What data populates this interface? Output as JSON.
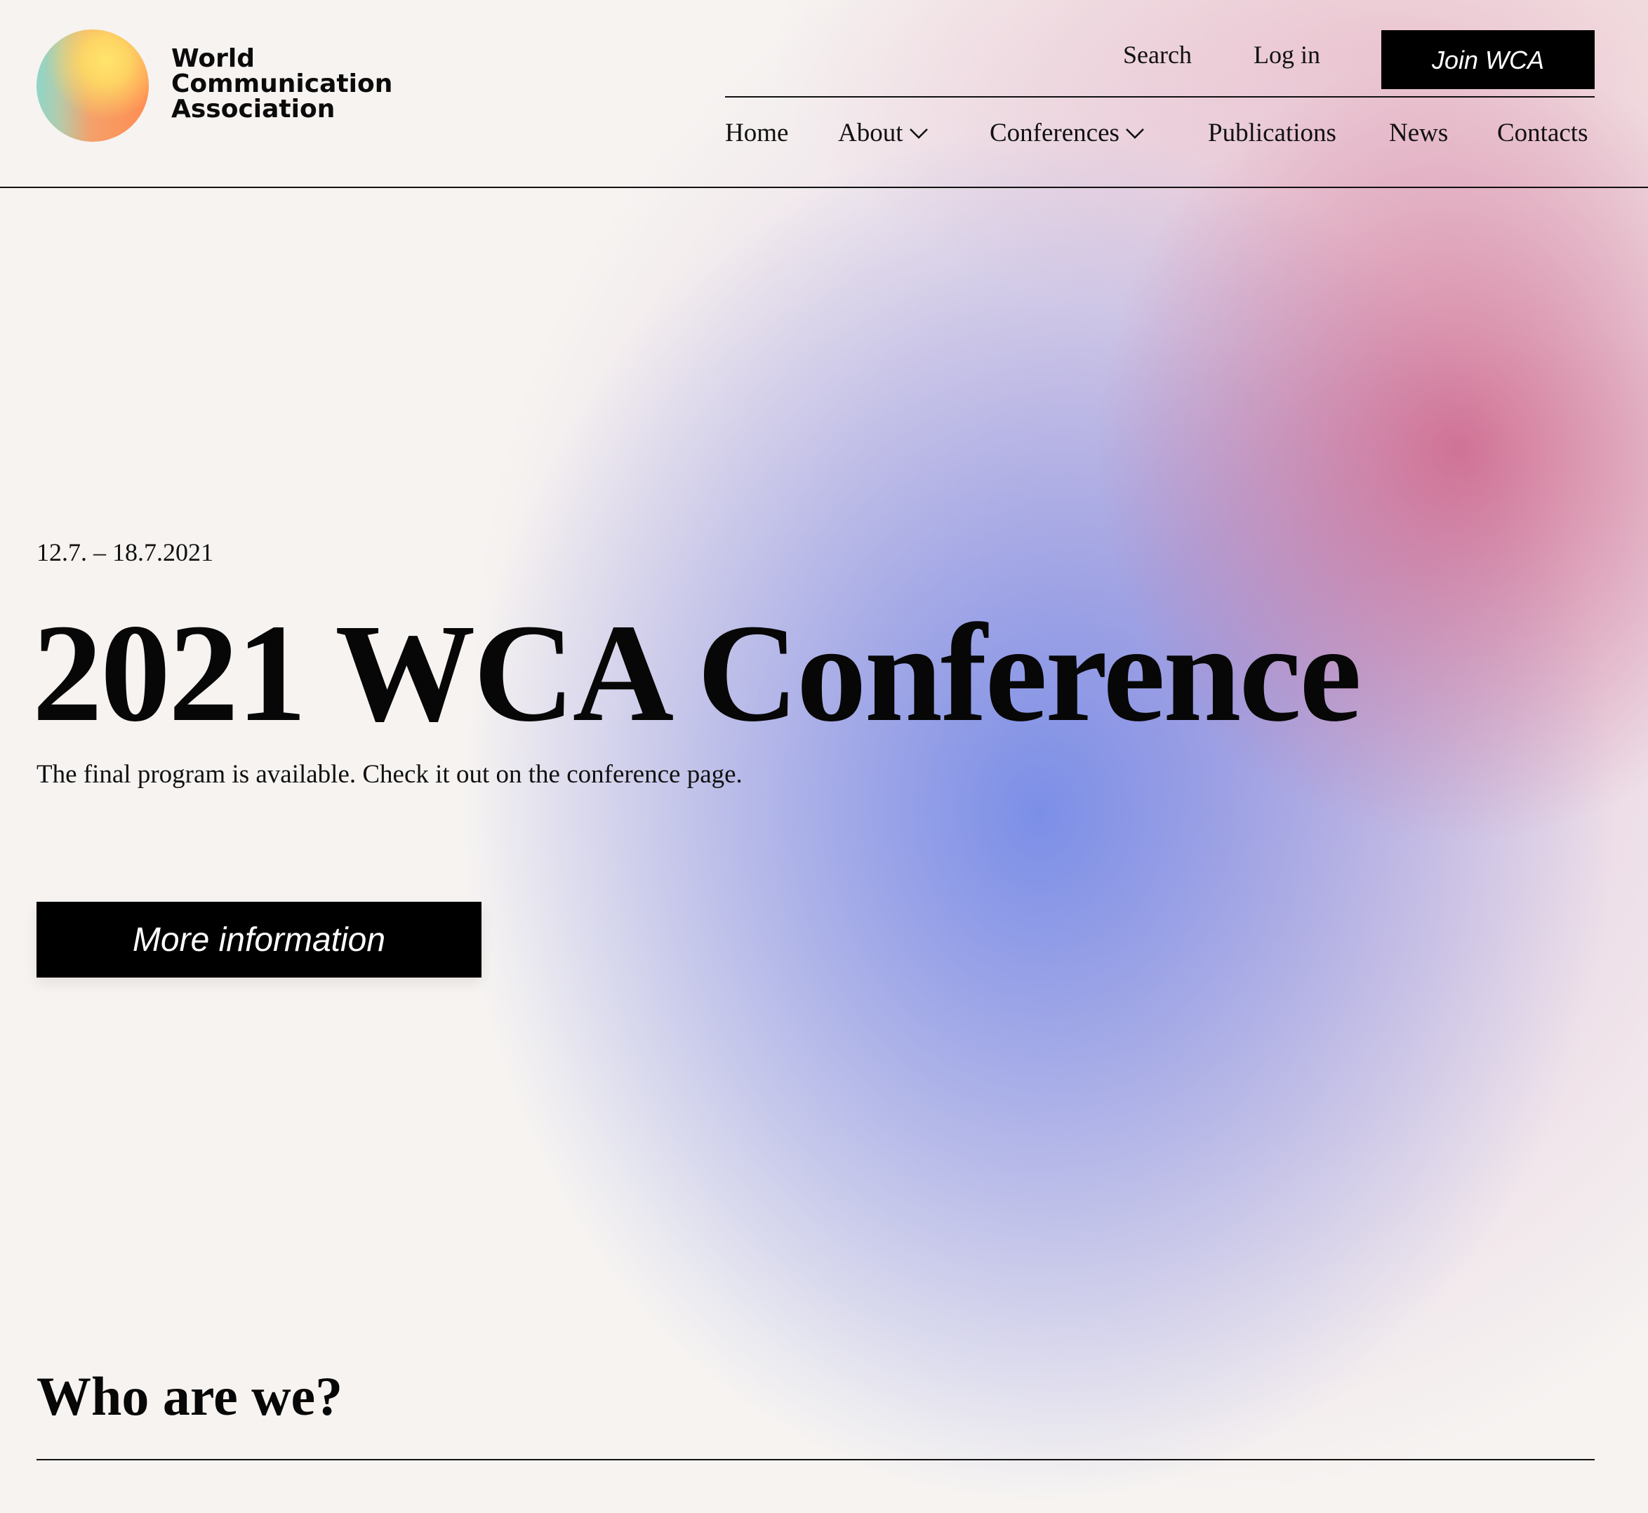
{
  "brand": {
    "line1": "World",
    "line2": "Communication",
    "line3": "Association"
  },
  "header": {
    "search_label": "Search",
    "login_label": "Log in",
    "join_label": "Join WCA"
  },
  "nav": {
    "home": "Home",
    "about": "About",
    "conferences": "Conferences",
    "publications": "Publications",
    "news": "News",
    "contacts": "Contacts"
  },
  "hero": {
    "date": "12.7. – 18.7.2021",
    "title": "2021 WCA Conference",
    "subtitle": "The final program is available. Check it out on the conference page.",
    "cta_label": "More information"
  },
  "sections": {
    "who_heading": "Who are we?"
  },
  "colors": {
    "button_bg": "#000000",
    "button_text": "#ffffff",
    "page_bg": "#f6f3f1",
    "blob_blue": "#7088e8",
    "blob_pink": "#cd5e84"
  },
  "icons": {
    "about_chevron": "chevron-down-icon",
    "conferences_chevron": "chevron-down-icon"
  }
}
